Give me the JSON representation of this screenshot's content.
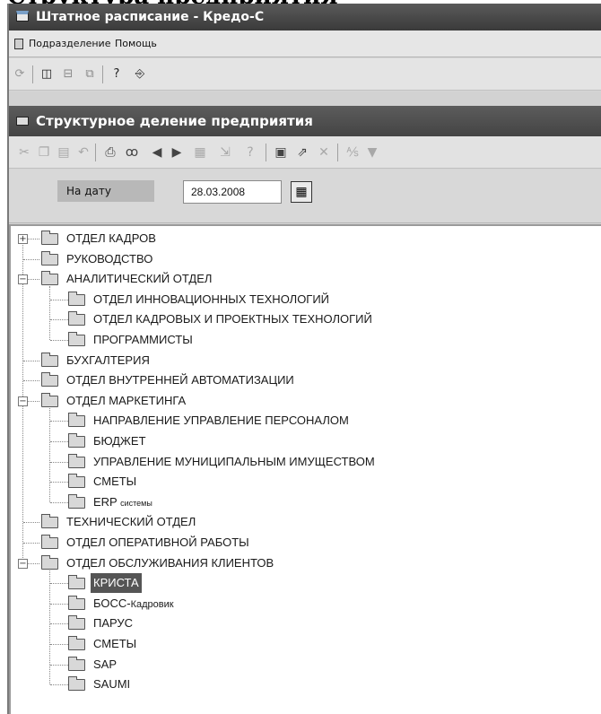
{
  "book_heading": "Структура предприятия",
  "window": {
    "title": "Штатное расписание - Кредо-С"
  },
  "menu": {
    "items": [
      "Подразделение",
      "Помощь"
    ]
  },
  "child_window": {
    "title": "Структурное деление предприятия"
  },
  "date_filter": {
    "label": "На дату",
    "value": "28.03.2008"
  },
  "tree": {
    "nodes": [
      {
        "label": "ОТДЕЛ КАДРОВ",
        "level": 0,
        "expander": "+"
      },
      {
        "label": "РУКОВОДСТВО",
        "level": 0
      },
      {
        "label": "АНАЛИТИЧЕСКИЙ ОТДЕЛ",
        "level": 0,
        "expander": "−"
      },
      {
        "label": "ОТДЕЛ ИННОВАЦИОННЫХ ТЕХНОЛОГИЙ",
        "level": 1
      },
      {
        "label": "ОТДЕЛ КАДРОВЫХ И ПРОЕКТНЫХ ТЕХНОЛОГИЙ",
        "level": 1
      },
      {
        "label": "ПРОГРАММИСТЫ",
        "level": 1
      },
      {
        "label": "БУХГАЛТЕРИЯ",
        "level": 0
      },
      {
        "label": "ОТДЕЛ ВНУТРЕННЕЙ АВТОМАТИЗАЦИИ",
        "level": 0
      },
      {
        "label": "ОТДЕЛ МАРКЕТИНГА",
        "level": 0,
        "expander": "−"
      },
      {
        "label": "НАПРАВЛЕНИЕ УПРАВЛЕНИЕ ПЕРСОНАЛОМ",
        "level": 1
      },
      {
        "label": "БЮДЖЕТ",
        "level": 1
      },
      {
        "label": "УПРАВЛЕНИЕ МУНИЦИПАЛЬНЫМ ИМУЩЕСТВОМ",
        "level": 1
      },
      {
        "label": "СМЕТЫ",
        "level": 1
      },
      {
        "label": "ERP системы",
        "level": 1,
        "mixed_case": true
      },
      {
        "label": "ТЕХНИЧЕСКИЙ ОТДЕЛ",
        "level": 0
      },
      {
        "label": "ОТДЕЛ ОПЕРАТИВНОЙ РАБОТЫ",
        "level": 0
      },
      {
        "label": "ОТДЕЛ ОБСЛУЖИВАНИЯ КЛИЕНТОВ",
        "level": 0,
        "expander": "−"
      },
      {
        "label": "КРИСТА",
        "level": 1,
        "selected": true
      },
      {
        "label": "БОСС-Кадровик",
        "level": 1,
        "mixed_case": true
      },
      {
        "label": "ПАРУС",
        "level": 1
      },
      {
        "label": "СМЕТЫ",
        "level": 1
      },
      {
        "label": "SAP",
        "level": 1
      },
      {
        "label": "SAUMI",
        "level": 1
      }
    ]
  }
}
